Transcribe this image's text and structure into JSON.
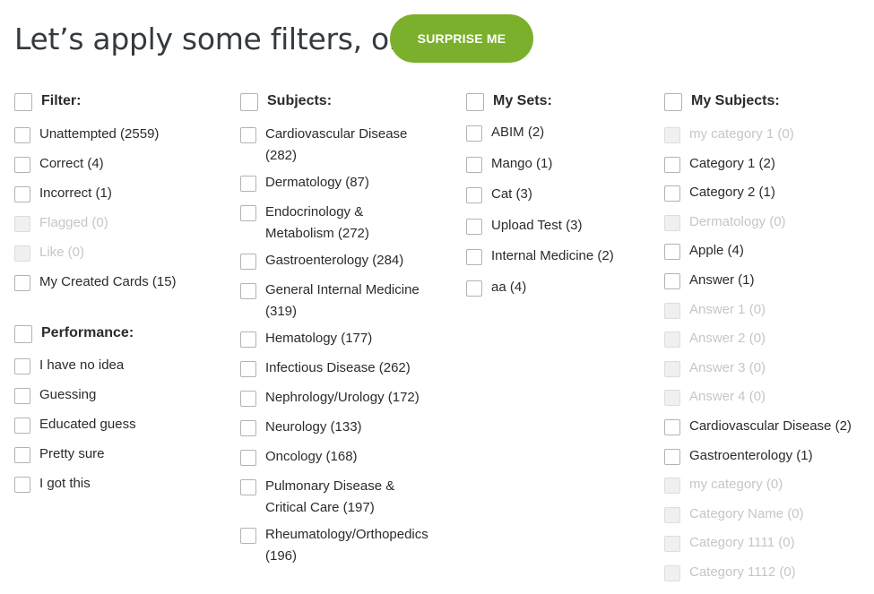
{
  "headline": "Let’s apply some filters, or",
  "surprise_button": "SURPRISE ME",
  "filter": {
    "heading": "Filter:",
    "items": [
      {
        "label": "Unattempted (2559)",
        "enabled": true
      },
      {
        "label": "Correct (4)",
        "enabled": true
      },
      {
        "label": "Incorrect (1)",
        "enabled": true
      },
      {
        "label": "Flagged (0)",
        "enabled": false
      },
      {
        "label": "Like (0)",
        "enabled": false
      },
      {
        "label": "My Created Cards (15)",
        "enabled": true
      }
    ]
  },
  "performance": {
    "heading": "Performance:",
    "items": [
      {
        "label": "I have no idea",
        "enabled": true
      },
      {
        "label": "Guessing",
        "enabled": true
      },
      {
        "label": "Educated guess",
        "enabled": true
      },
      {
        "label": "Pretty sure",
        "enabled": true
      },
      {
        "label": "I got this",
        "enabled": true
      }
    ]
  },
  "subjects": {
    "heading": "Subjects:",
    "items": [
      {
        "label": "Cardiovascular Disease (282)",
        "lines": 2,
        "enabled": true
      },
      {
        "label": "Dermatology (87)",
        "lines": 1,
        "enabled": true
      },
      {
        "label": "Endocrinology & Metabolism (272)",
        "lines": 2,
        "enabled": true
      },
      {
        "label": "Gastroenterology (284)",
        "lines": 1,
        "enabled": true
      },
      {
        "label": "General Internal Medicine (319)",
        "lines": 2,
        "enabled": true
      },
      {
        "label": "Hematology (177)",
        "lines": 1,
        "enabled": true
      },
      {
        "label": "Infectious Disease (262)",
        "lines": 1,
        "enabled": true
      },
      {
        "label": "Nephrology/Urology (172)",
        "lines": 1,
        "enabled": true
      },
      {
        "label": "Neurology (133)",
        "lines": 1,
        "enabled": true
      },
      {
        "label": "Oncology (168)",
        "lines": 1,
        "enabled": true
      },
      {
        "label": "Pulmonary Disease & Critical Care (197)",
        "lines": 2,
        "enabled": true
      },
      {
        "label": "Rheumatology/Orthopedics (196)",
        "lines": 2,
        "enabled": true
      }
    ]
  },
  "my_sets": {
    "heading": "My Sets:",
    "items": [
      {
        "label": "ABIM (2)",
        "enabled": true
      },
      {
        "label": "Mango (1)",
        "enabled": true
      },
      {
        "label": "Cat (3)",
        "enabled": true
      },
      {
        "label": "Upload Test (3)",
        "enabled": true
      },
      {
        "label": "Internal Medicine (2)",
        "enabled": true
      },
      {
        "label": "aa (4)",
        "enabled": true
      }
    ]
  },
  "my_subjects": {
    "heading": "My Subjects:",
    "items": [
      {
        "label": "my category 1 (0)",
        "enabled": false
      },
      {
        "label": "Category 1 (2)",
        "enabled": true
      },
      {
        "label": "Category 2 (1)",
        "enabled": true
      },
      {
        "label": "Dermatology (0)",
        "enabled": false
      },
      {
        "label": "Apple (4)",
        "enabled": true
      },
      {
        "label": "Answer (1)",
        "enabled": true
      },
      {
        "label": "Answer 1 (0)",
        "enabled": false
      },
      {
        "label": "Answer 2 (0)",
        "enabled": false
      },
      {
        "label": "Answer 3 (0)",
        "enabled": false
      },
      {
        "label": "Answer 4 (0)",
        "enabled": false
      },
      {
        "label": "Cardiovascular Disease (2)",
        "enabled": true
      },
      {
        "label": "Gastroenterology (1)",
        "enabled": true
      },
      {
        "label": "my category (0)",
        "enabled": false
      },
      {
        "label": "Category Name (0)",
        "enabled": false
      },
      {
        "label": "Category 1111 (0)",
        "enabled": false
      },
      {
        "label": "Category 1112 (0)",
        "enabled": false
      }
    ]
  },
  "colors": {
    "accent": "#7ab02b",
    "disabled_text": "#c4c6c8"
  }
}
